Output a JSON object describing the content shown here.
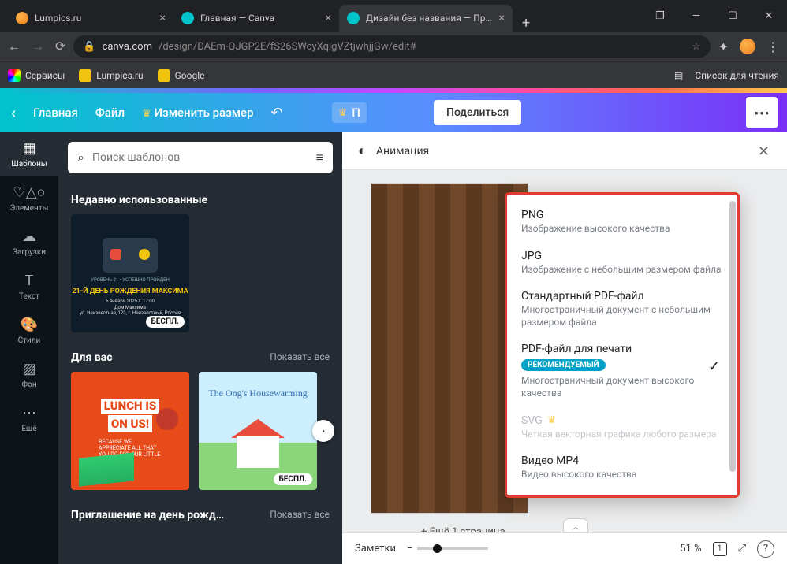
{
  "tabs": [
    {
      "title": "Lumpics.ru",
      "color": "#e67e22"
    },
    {
      "title": "Главная — Canva",
      "color": "#00c4cc"
    },
    {
      "title": "Дизайн без названия — Пригл",
      "color": "#00c4cc"
    }
  ],
  "window": {
    "new_tab": "+"
  },
  "address": {
    "host": "canva.com",
    "path": "/design/DAEm-QJGP2E/fS26SWcyXqlgVZtjwhjjGw/edit#"
  },
  "bookmarks": {
    "services": "Сервисы",
    "lumpics": "Lumpics.ru",
    "google": "Google",
    "reading_list": "Список для чтения"
  },
  "topnav": {
    "home": "Главная",
    "file": "Файл",
    "resize": "Изменить размер",
    "premium_p": "П",
    "share": "Поделиться"
  },
  "rail": {
    "templates": "Шаблоны",
    "elements": "Элементы",
    "uploads": "Загрузки",
    "text": "Текст",
    "styles": "Стили",
    "bg": "Фон",
    "more": "Ещё"
  },
  "panel": {
    "search_placeholder": "Поиск шаблонов",
    "recent": "Недавно использованные",
    "foryou": "Для вас",
    "show_all": "Показать все",
    "invite_sec": "Приглашение на день рожд…",
    "free_badge": "БЕСПЛ.",
    "tpl_dark_line1": "УРОВЕНЬ 21 • УСПЕШНО ПРОЙДЕН",
    "tpl_dark_line2": "21-Й ДЕНЬ РОЖДЕНИЯ МАКСИМА",
    "tpl_lunch_top": "LUNCH IS",
    "tpl_lunch_bot": "ON US!",
    "tpl_lunch_sub": "BECAUSE WE APPRECIATE ALL THAT YOU DO FOR OUR LITTLE ONES",
    "tpl_ongs": "The Ong's Housewarming"
  },
  "canvas": {
    "animation": "Анимация",
    "add_page": "+ Ещё 1 страница",
    "notes": "Заметки",
    "zoom": "51 %",
    "page_num": "1"
  },
  "dropdown": {
    "items": [
      {
        "title": "PNG",
        "desc": "Изображение высокого качества"
      },
      {
        "title": "JPG",
        "desc": "Изображение с небольшим размером файла"
      },
      {
        "title": "Стандартный PDF-файл",
        "desc": "Многостраничный документ с небольшим размером файла"
      },
      {
        "title": "PDF-файл для печати",
        "badge": "РЕКОМЕНДУЕМЫЙ",
        "desc": "Многостраничный документ высокого качества",
        "selected": true
      },
      {
        "title": "SVG",
        "pro": true,
        "desc": "Четкая векторная графика любого размера"
      },
      {
        "title": "Видео MP4",
        "desc": "Видео высокого качества"
      }
    ]
  }
}
